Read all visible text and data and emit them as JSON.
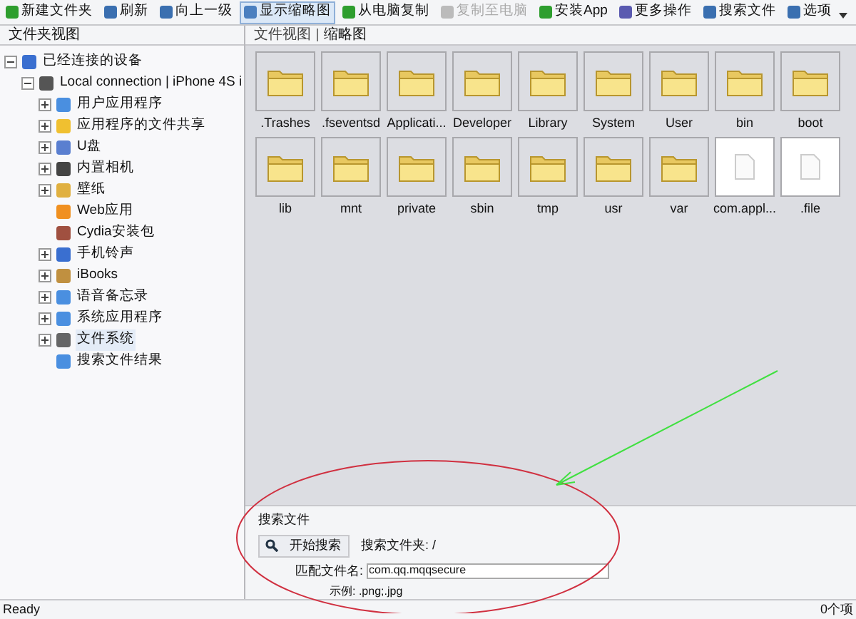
{
  "toolbar": [
    {
      "label": "新建文件夹",
      "selected": false,
      "disabled": false
    },
    {
      "label": "刷新",
      "selected": false,
      "disabled": false
    },
    {
      "label": "向上一级",
      "selected": false,
      "disabled": false
    },
    {
      "label": "显示缩略图",
      "selected": true,
      "disabled": false
    },
    {
      "label": "从电脑复制",
      "selected": false,
      "disabled": false
    },
    {
      "label": "复制至电脑",
      "selected": false,
      "disabled": true
    },
    {
      "label": "安装App",
      "selected": false,
      "disabled": false
    },
    {
      "label": "更多操作",
      "selected": false,
      "disabled": false
    },
    {
      "label": "搜索文件",
      "selected": false,
      "disabled": false
    },
    {
      "label": "选项",
      "selected": false,
      "disabled": false
    }
  ],
  "sidebar": {
    "title": "文件夹视图",
    "tree": [
      {
        "label": "已经连接的设备",
        "expanded": true,
        "children": [
          {
            "label": "Local connection | iPhone 4S i",
            "expanded": true,
            "children": [
              {
                "label": "用户应用程序",
                "expanded": false
              },
              {
                "label": "应用程序的文件共享",
                "expanded": false
              },
              {
                "label": "U盘",
                "expanded": false
              },
              {
                "label": "内置相机",
                "expanded": false
              },
              {
                "label": "壁纸",
                "expanded": false
              },
              {
                "label": "Web应用"
              },
              {
                "label": "Cydia安装包"
              },
              {
                "label": "手机铃声",
                "expanded": false
              },
              {
                "label": "iBooks",
                "expanded": false
              },
              {
                "label": "语音备忘录",
                "expanded": false
              },
              {
                "label": "系统应用程序",
                "expanded": false
              },
              {
                "label": "文件系统",
                "expanded": false,
                "selected": true
              },
              {
                "label": "搜索文件结果"
              }
            ]
          }
        ]
      }
    ]
  },
  "view_tabs": [
    {
      "label": "文件视图",
      "selected": false
    },
    {
      "label": "缩略图",
      "selected": true
    }
  ],
  "files": [
    {
      "name": ".Trashes",
      "kind": "folder"
    },
    {
      "name": ".fseventsd",
      "kind": "folder"
    },
    {
      "name": "Applicati...",
      "kind": "folder"
    },
    {
      "name": "Developer",
      "kind": "folder"
    },
    {
      "name": "Library",
      "kind": "folder"
    },
    {
      "name": "System",
      "kind": "folder"
    },
    {
      "name": "User",
      "kind": "folder"
    },
    {
      "name": "bin",
      "kind": "folder"
    },
    {
      "name": "boot",
      "kind": "folder"
    },
    {
      "name": "lib",
      "kind": "folder"
    },
    {
      "name": "mnt",
      "kind": "folder"
    },
    {
      "name": "private",
      "kind": "folder"
    },
    {
      "name": "sbin",
      "kind": "folder"
    },
    {
      "name": "tmp",
      "kind": "folder"
    },
    {
      "name": "usr",
      "kind": "folder"
    },
    {
      "name": "var",
      "kind": "folder"
    },
    {
      "name": "com.appl...",
      "kind": "file"
    },
    {
      "name": ".file",
      "kind": "file"
    }
  ],
  "search_panel": {
    "title": "搜索文件",
    "button": "开始搜索",
    "folder": "搜索文件夹: /",
    "field_label": "匹配文件名:",
    "value": "com.qq.mqqsecure",
    "example": "示例: .png;.jpg"
  },
  "status_bar": {
    "left": "Ready",
    "right": "0个项"
  }
}
